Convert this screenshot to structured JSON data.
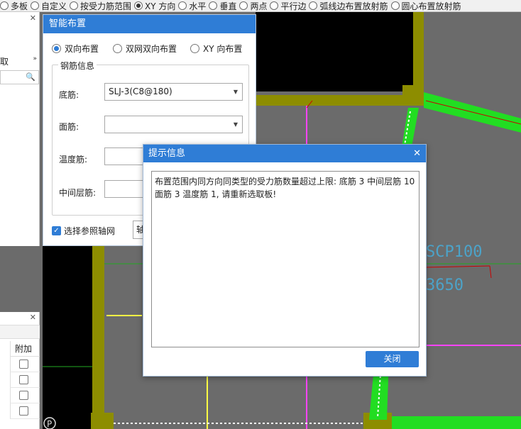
{
  "toolbar": {
    "options": [
      {
        "label": "多板",
        "checked": false,
        "icon": "radio-icon"
      },
      {
        "label": "自定义",
        "checked": false,
        "icon": "radio-icon"
      },
      {
        "label": "按受力筋范围",
        "checked": false,
        "icon": "radio-icon"
      },
      {
        "label": "XY 方向",
        "checked": true,
        "icon": "radio-icon"
      },
      {
        "label": "水平",
        "checked": false,
        "icon": "radio-icon"
      },
      {
        "label": "垂直",
        "checked": false,
        "icon": "radio-icon"
      },
      {
        "label": "两点",
        "checked": false,
        "icon": "radio-icon"
      },
      {
        "label": "平行边",
        "checked": false,
        "icon": "radio-icon"
      },
      {
        "label": "弧线边布置放射筋",
        "checked": false,
        "icon": "radio-icon"
      },
      {
        "label": "圆心布置放射筋",
        "checked": false,
        "icon": "radio-icon"
      }
    ]
  },
  "left_panel": {
    "top": {
      "title": "取",
      "close_icon": "close-icon",
      "arrow": "»",
      "search_icon": "search-icon"
    },
    "bottom": {
      "close_icon": "close-icon",
      "column": "附加",
      "rows": 4
    }
  },
  "smart_dialog": {
    "title": "智能布置",
    "modes": [
      {
        "label": "双向布置",
        "selected": true
      },
      {
        "label": "双网双向布置",
        "selected": false
      },
      {
        "label": "XY 向布置",
        "selected": false
      }
    ],
    "group_title": "钢筋信息",
    "fields": [
      {
        "label": "底筋:",
        "value": "SLJ-3(C8@180)"
      },
      {
        "label": "面筋:",
        "value": ""
      },
      {
        "label": "温度筋:",
        "value": ""
      },
      {
        "label": "中间层筋:",
        "value": ""
      }
    ],
    "checkbox_label": "选择参照轴网",
    "checkbox_checked": true,
    "axis_select_value": "轴"
  },
  "prompt_dialog": {
    "title": "提示信息",
    "message": "布置范围内同方向同类型的受力筋数量超过上限: 底筋 3 中间层筋 10 面筋 3 温度筋 1, 请重新选取板!",
    "close_button": "关闭"
  },
  "canvas": {
    "labels": [
      "SCP100",
      "3650"
    ],
    "marker": "P"
  },
  "colors": {
    "titlebar": "#2f7dd6",
    "olive": "#8d8d00",
    "green": "#22dd22",
    "magenta": "#ff44ff",
    "canvas_bg": "#6b6b6b"
  }
}
